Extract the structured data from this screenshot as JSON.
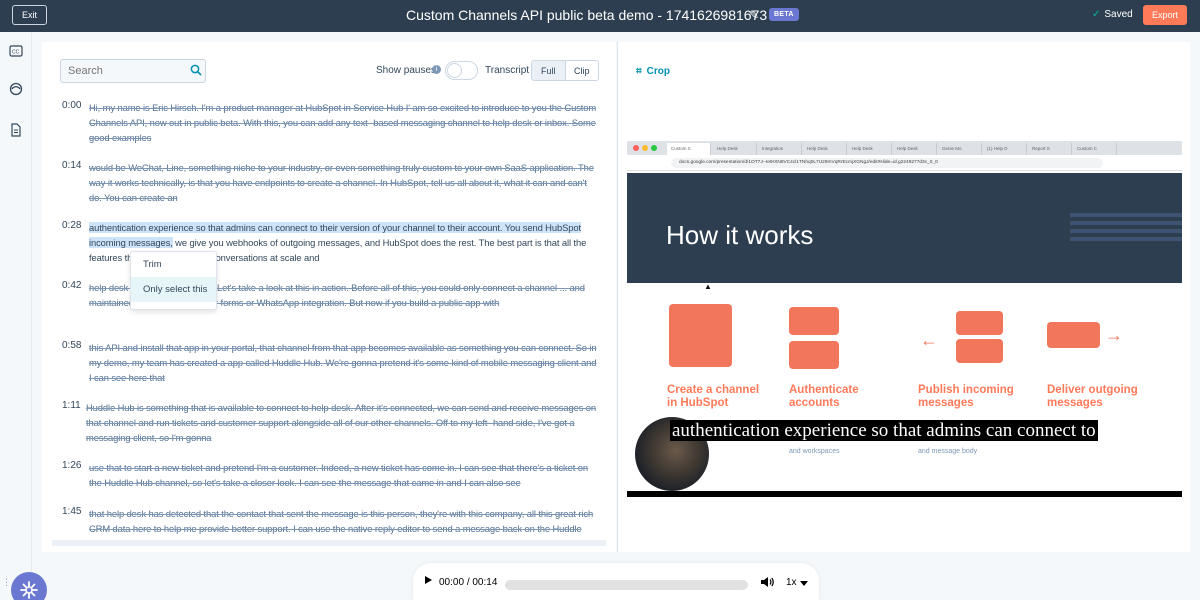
{
  "header": {
    "exit_label": "Exit",
    "title": "Custom Channels API public beta demo - 1741626981673",
    "beta_badge": "BETA",
    "saved_label": "Saved",
    "export_label": "Export"
  },
  "rail": {
    "icons": [
      "closed-captions-icon",
      "palette-icon",
      "document-icon"
    ]
  },
  "toolbar": {
    "search_placeholder": "Search",
    "show_pauses_label": "Show pauses",
    "show_pauses_on": false,
    "transcript_label": "Transcript",
    "view_options": [
      "Full",
      "Clip"
    ],
    "view_selected": "Full"
  },
  "transcript": {
    "segments": [
      {
        "time": "0:00",
        "text": "Hi, my name is Eric Hirsch. I'm a product manager at HubSpot in Service Hub I' am so excited to introduce to you the Custom Channels API, now out in public beta. With this, you can add any text- based messaging channel to help desk or inbox. Some good examples"
      },
      {
        "time": "0:14",
        "text": "would be WeChat, Line, something niche to your industry, or even something truly custom to your own SaaS application. The way it works technically, is that you have endpoints to create a channel. In HubSpot, tell us all about it, what it can and can't do. You can create an"
      },
      {
        "time": "0:28",
        "text_highlighted": "authentication experience so that admins can connect to their version of your channel to their account. You send HubSpot incoming messages,",
        "text_rest": " we give you webhooks of outgoing messages, and HubSpot does the rest. The best part is that all the features that are ... managing conversations at scale and"
      },
      {
        "time": "0:42",
        "text": "help desk ... with your channel. Let's take a look at this in action. Before all of this, you could only connect a channel ... and maintained, like email or chat or forms or WhatsApp integration. But now if you build a public app with"
      },
      {
        "time": "0:58",
        "text": "this API and install that app in your portal, that channel from that app becomes available as something you can connect. So in my demo, my team has created a app called Huddle Hub. We're gonna pretend it's some kind of mobile messaging client and I can see here that"
      },
      {
        "time": "1:11",
        "text": "Huddle Hub is something that is available to connect to help desk. After it's connected, we can send and receive messages on that channel and run tickets and customer support alongside all of our other channels. Off to my left- hand side, I've got a messaging client, so I'm gonna"
      },
      {
        "time": "1:26",
        "text": "use that to start a new ticket and pretend I'm a customer. Indeed, a new ticket has come in. I can see that there's a ticket on the Huddle Hub channel, so let's take a closer look. I can see the message that came in and I can also see"
      },
      {
        "time": "1:45",
        "text": "that help desk has detected that the contact that sent the message is this person, they're with this company, all this great rich CRM data here to help me provide better support. I can use the native reply editor to send a message back on the Huddle Hub channel and"
      }
    ],
    "context_menu": [
      "Trim",
      "Only select this"
    ]
  },
  "preview": {
    "crop_label": "Crop",
    "browser_tabs": [
      "Custom C",
      "Help Desk",
      "Integration",
      "Help Desk",
      "Help Desk",
      "Help Desk",
      "Genie Mo",
      "(1) Help D",
      "Report S",
      "Custom C"
    ],
    "url": "docs.google.com/presentation/d/1OT7J--Ie9rXN8VC4cl1TNhq0L7U29mVqRrEcmjXGNgJ/edit#slide=id.g2249277d3c_0_0",
    "slide_title": "How it works",
    "features": [
      {
        "title": "Create a channel in HubSpot",
        "sub": ""
      },
      {
        "title": "Authenticate accounts",
        "sub": "and workspaces"
      },
      {
        "title": "Publish incoming messages",
        "sub": "and message body"
      },
      {
        "title": "Deliver outgoing messages",
        "sub": ""
      }
    ],
    "caption": "authentication experience so that admins can connect to"
  },
  "player": {
    "current_time": "00:00",
    "separator": "/",
    "duration": "00:14",
    "progress": 0.0,
    "speed": "1x"
  },
  "colors": {
    "topbar": "#2d3e50",
    "accent": "#ff7a59",
    "link": "#0091ae",
    "beta": "#6a78d1",
    "highlight": "#cde3f7"
  }
}
